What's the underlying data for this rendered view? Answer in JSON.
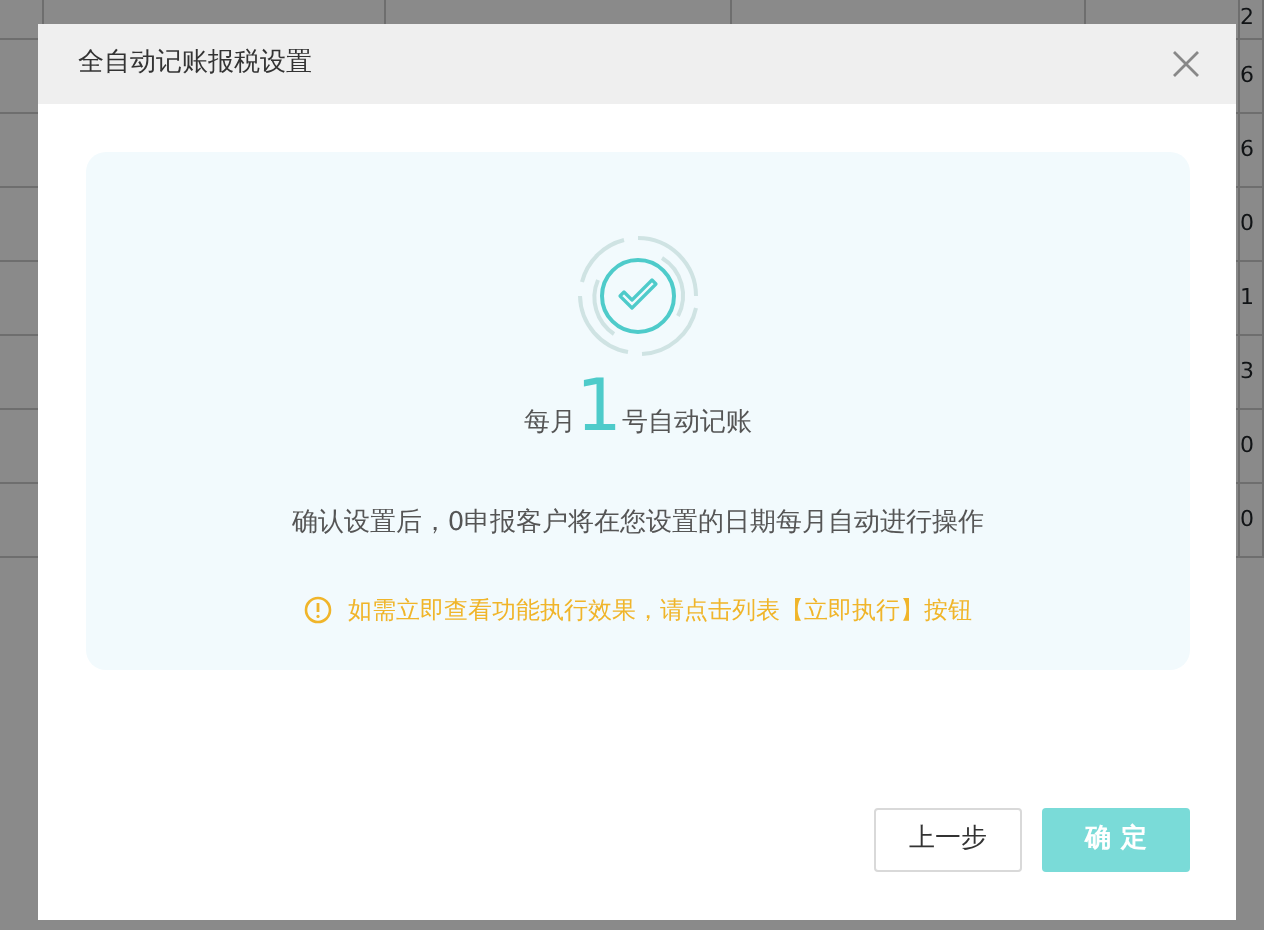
{
  "background_table": {
    "rows": [
      {
        "column_5": "2"
      },
      {
        "column_5": "6"
      },
      {
        "column_5": "6"
      },
      {
        "column_5": "0"
      },
      {
        "column_5": "1"
      },
      {
        "column_5": "3"
      },
      {
        "column_5": "0"
      },
      {
        "column_5": "0"
      }
    ]
  },
  "dialog": {
    "title": "全自动记账报税设置",
    "schedule": {
      "prefix": "每月",
      "day": "1",
      "suffix": "号自动记账"
    },
    "description": "确认设置后，0申报客户将在您设置的日期每月自动进行操作",
    "notice": "如需立即查看功能执行效果，请点击列表【立即执行】按钮",
    "buttons": [
      {
        "label": "上一步",
        "kind": "secondary"
      },
      {
        "label": "确 定",
        "kind": "primary"
      }
    ]
  }
}
